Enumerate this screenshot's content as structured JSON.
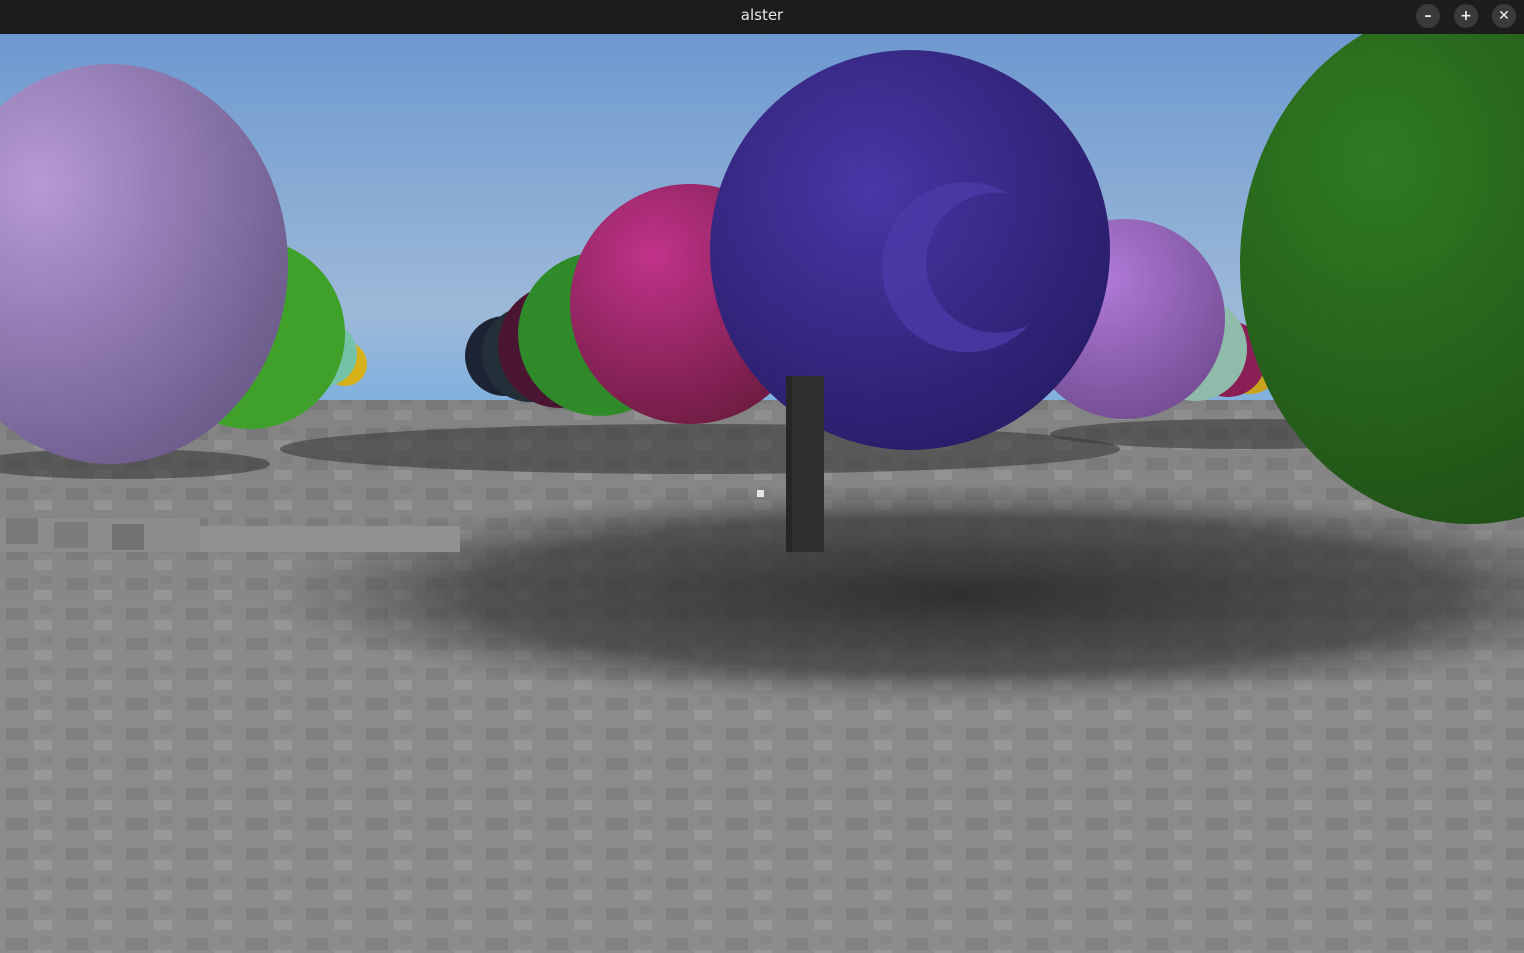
{
  "window": {
    "title": "alster",
    "buttons": {
      "minimize_icon": "minimize-icon",
      "maximize_icon": "maximize-icon",
      "close_icon": "close-icon",
      "minimize_glyph": "–",
      "maximize_glyph": "+",
      "close_glyph": "✕"
    }
  },
  "scene": {
    "sky_top": "#6f9bd1",
    "sky_bottom": "#9cbad9",
    "horizon_haze": "#7fb3e0",
    "floor_light": "#8f8f8f",
    "floor_dark": "#555555",
    "shadow": "#2f2f2f",
    "sphere_colors": [
      "#a98bc8",
      "#6cc43a",
      "#3b2a8a",
      "#b12f7a",
      "#2e8a30",
      "#a86ad0",
      "#8fbfae",
      "#d8b21a",
      "#2a6b1e"
    ],
    "crosshair": "#e6e6e6"
  }
}
